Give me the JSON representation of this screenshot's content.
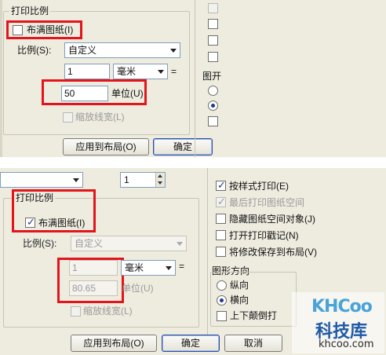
{
  "top_panel": {
    "group_title": "打印比例",
    "fit_to_paper_label": "布满图纸",
    "fit_to_paper_mnemonic": "(I)",
    "scale_label": "比例",
    "scale_mnemonic": "(S):",
    "scale_value": "自定义",
    "units_value": "1",
    "unit_select": "毫米",
    "unit_eq": "=",
    "units_input": "50",
    "unit_label": "单位",
    "unit_mnemonic": "(U)",
    "scale_lineweights_label": "缩放线宽",
    "scale_lineweights_mnemonic": "(L)",
    "apply_button": "应用到布局",
    "apply_mnemonic": "(O)",
    "ok_button": "确定",
    "right_partial_label": "图开"
  },
  "bottom_panel": {
    "offset_value": "1",
    "group_title": "打印比例",
    "fit_to_paper_label": "布满图纸",
    "fit_to_paper_mnemonic": "(I)",
    "scale_label": "比例",
    "scale_mnemonic": "(S):",
    "scale_value": "自定义",
    "units_value": "1",
    "unit_select": "毫米",
    "unit_eq": "=",
    "units_input": "80.65",
    "unit_label": "单位",
    "unit_mnemonic": "(U)",
    "scale_lineweights_label": "缩放线宽",
    "scale_lineweights_mnemonic": "(L)",
    "apply_button": "应用到布局",
    "apply_mnemonic": "(O)",
    "ok_button": "确定",
    "cancel_button": "取消",
    "options": [
      {
        "label": "按样式打印",
        "mnemonic": "(E)",
        "checked": true,
        "disabled": false
      },
      {
        "label": "最后打印图纸空间",
        "mnemonic": "",
        "checked": true,
        "disabled": true
      },
      {
        "label": "隐藏图纸空间对象",
        "mnemonic": "(J)",
        "checked": false,
        "disabled": false
      },
      {
        "label": "打开打印戳记",
        "mnemonic": "(N)",
        "checked": false,
        "disabled": false
      },
      {
        "label": "将修改保存到布局",
        "mnemonic": "(V)",
        "checked": false,
        "disabled": false
      }
    ],
    "orientation_title": "图形方向",
    "orientation_portrait": "纵向",
    "orientation_landscape": "横向",
    "upside_down": "上下颠倒打"
  },
  "watermark": {
    "logo": "KHCoo",
    "cn": "科技库",
    "url": "khcoo.com"
  },
  "colors": {
    "highlight": "#e3141b",
    "dialog_bg": "#eeecdf",
    "accent": "#1a3a91"
  }
}
